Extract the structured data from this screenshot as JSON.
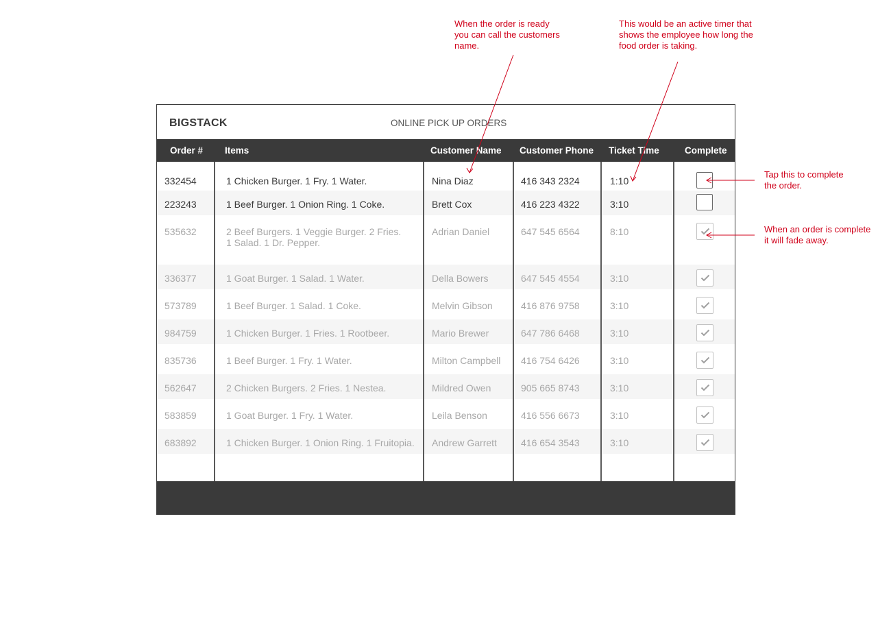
{
  "annotations": {
    "ready_note": "When the order is ready\nyou can call the customers\nname.",
    "timer_note": "This would be an active timer that\nshows the employee how long the\nfood order is taking.",
    "tap_note": "Tap this to complete\nthe order.",
    "fade_note": "When an order is complete\nit will fade away."
  },
  "header": {
    "brand": "BIGSTACK",
    "title": "ONLINE PICK UP ORDERS"
  },
  "columns": {
    "order": "Order #",
    "items": "Items",
    "name": "Customer Name",
    "phone": "Customer Phone",
    "time": "Ticket Time",
    "complete": "Complete"
  },
  "orders": [
    {
      "order": "332454",
      "items": "1 Chicken Burger. 1 Fry. 1 Water.",
      "name": "Nina Diaz",
      "phone": "416 343 2324",
      "time": "1:10",
      "complete": false
    },
    {
      "order": "223243",
      "items": "1 Beef Burger. 1 Onion Ring. 1 Coke.",
      "name": "Brett Cox",
      "phone": "416 223 4322",
      "time": "3:10",
      "complete": false
    },
    {
      "order": "535632",
      "items": "2 Beef Burgers. 1 Veggie Burger. 2 Fries.\n1 Salad. 1 Dr. Pepper.",
      "name": "Adrian Daniel",
      "phone": "647 545 6564",
      "time": "8:10",
      "complete": true
    },
    {
      "order": "336377",
      "items": "1 Goat Burger. 1 Salad. 1 Water.",
      "name": "Della Bowers",
      "phone": "647 545 4554",
      "time": "3:10",
      "complete": true
    },
    {
      "order": "573789",
      "items": "1 Beef Burger. 1 Salad. 1 Coke.",
      "name": "Melvin Gibson",
      "phone": "416 876 9758",
      "time": "3:10",
      "complete": true
    },
    {
      "order": "984759",
      "items": "1 Chicken Burger. 1 Fries. 1 Rootbeer.",
      "name": "Mario Brewer",
      "phone": "647 786 6468",
      "time": "3:10",
      "complete": true
    },
    {
      "order": "835736",
      "items": "1 Beef Burger. 1 Fry. 1 Water.",
      "name": "Milton Campbell",
      "phone": "416 754 6426",
      "time": "3:10",
      "complete": true
    },
    {
      "order": "562647",
      "items": "2 Chicken Burgers. 2 Fries. 1 Nestea.",
      "name": "Mildred Owen",
      "phone": "905 665 8743",
      "time": "3:10",
      "complete": true
    },
    {
      "order": "583859",
      "items": "1 Goat Burger. 1 Fry. 1 Water.",
      "name": "Leila Benson",
      "phone": "416 556 6673",
      "time": "3:10",
      "complete": true
    },
    {
      "order": "683892",
      "items": "1 Chicken Burger. 1 Onion Ring. 1 Fruitopia.",
      "name": "Andrew Garrett",
      "phone": "416 654 3543",
      "time": "3:10",
      "complete": true
    }
  ],
  "colors": {
    "annotation": "#d0021b",
    "header_bar": "#3a3a3a",
    "faded_text": "#a8a8a8"
  },
  "icons": {
    "complete_mark": "check-icon"
  }
}
